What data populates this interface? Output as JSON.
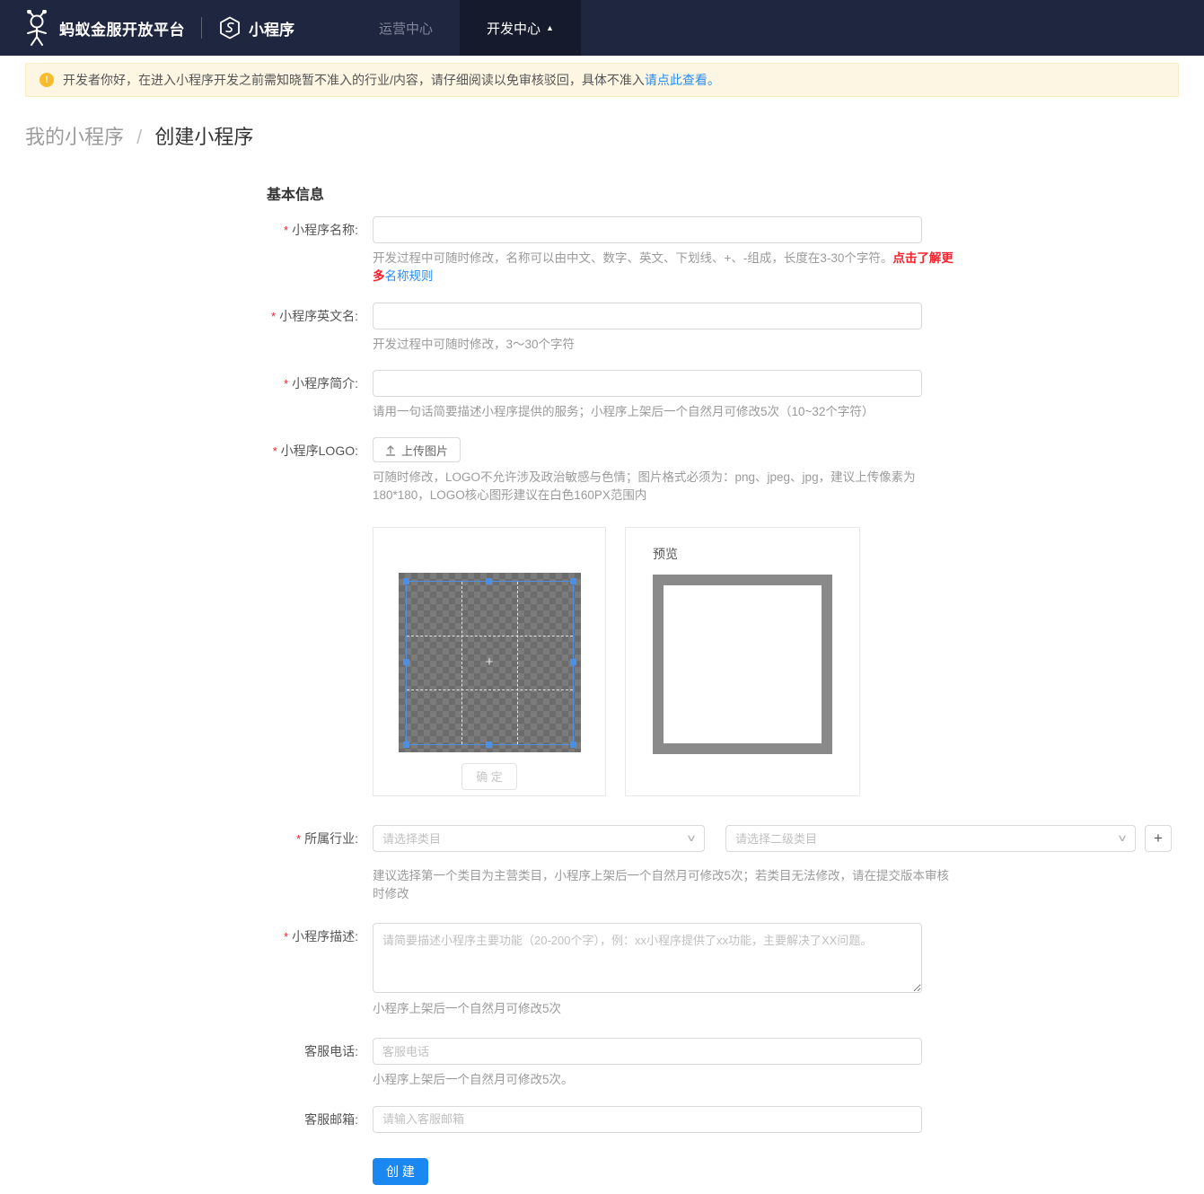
{
  "colors": {
    "navbar_bg": "#1f2640",
    "navbar_active_bg": "#151b2d",
    "banner_bg": "#fdf6e3",
    "warning_orange": "#f9bb2d",
    "link_blue": "#2b8cf0",
    "danger_red": "#f5222d",
    "primary_button_blue": "#1b87f0",
    "crop_accent_blue": "#4a90e8",
    "preview_border_gray": "#8a8a8a"
  },
  "icons": {
    "warning": "!",
    "caret_up": "▲",
    "chevron_down": "∨",
    "plus": "+",
    "crosshair": "+"
  },
  "navbar": {
    "brand": "蚂蚁金服开放平台",
    "product": "小程序",
    "items": [
      {
        "label": "运营中心"
      },
      {
        "label": "开发中心"
      }
    ]
  },
  "banner": {
    "text": "开发者你好，在进入小程序开发之前需知晓暂不准入的行业/内容，请仔细阅读以免审核驳回，具体不准入",
    "link": "请点此查看。"
  },
  "breadcrumb": {
    "parent": "我的小程序",
    "separator": "/",
    "current": "创建小程序"
  },
  "form": {
    "section_title": "基本信息",
    "required_mark": "*",
    "name": {
      "label": "小程序名称:",
      "value": "",
      "help": "开发过程中可随时修改，名称可以由中文、数字、英文、下划线、+、-组成，长度在3-30个字符。",
      "help_emphasis": "点击了解更多",
      "help_link": "名称规则"
    },
    "en_name": {
      "label": "小程序英文名:",
      "value": "",
      "help": "开发过程中可随时修改，3～30个字符"
    },
    "intro": {
      "label": "小程序简介:",
      "value": "",
      "help": "请用一句话简要描述小程序提供的服务；小程序上架后一个自然月可修改5次（10~32个字符）"
    },
    "logo": {
      "label": "小程序LOGO:",
      "upload_button": "上传图片",
      "help": "可随时修改，LOGO不允许涉及政治敏感与色情；图片格式必须为：png、jpeg、jpg，建议上传像素为180*180，LOGO核心图形建议在白色160PX范围内",
      "confirm_button": "确 定",
      "preview_title": "预览"
    },
    "industry": {
      "label": "所属行业:",
      "category_placeholder": "请选择类目",
      "subcategory_placeholder": "请选择二级类目",
      "help": "建议选择第一个类目为主营类目，小程序上架后一个自然月可修改5次；若类目无法修改，请在提交版本审核时修改"
    },
    "description": {
      "label": "小程序描述:",
      "placeholder": "请简要描述小程序主要功能（20-200个字），例：xx小程序提供了xx功能，主要解决了XX问题。",
      "value": "",
      "help": "小程序上架后一个自然月可修改5次"
    },
    "phone": {
      "label": "客服电话:",
      "placeholder": "客服电话",
      "value": "",
      "help": "小程序上架后一个自然月可修改5次。"
    },
    "email": {
      "label": "客服邮箱:",
      "placeholder": "请输入客服邮箱",
      "value": ""
    },
    "submit_button": "创 建"
  }
}
